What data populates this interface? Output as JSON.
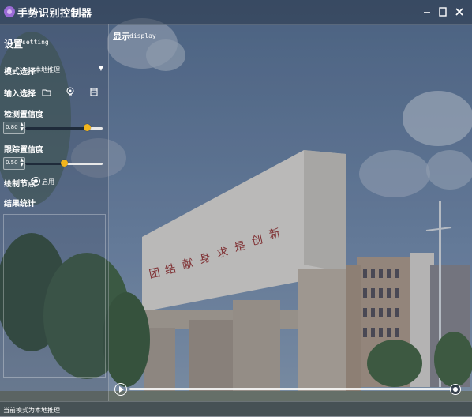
{
  "window": {
    "title": "手势识别控制器",
    "minimize_glyph": "—",
    "maximize_glyph": "☐",
    "close_glyph": "X"
  },
  "settings": {
    "title": "设置",
    "subtitle": "setting",
    "mode_label": "模式选择",
    "mode_value": "本地推理",
    "input_label": "输入选择",
    "input_icons": [
      "folder-icon",
      "camera-icon",
      "file-icon"
    ],
    "det_conf_label": "检测置信度",
    "det_conf_value": "0.80",
    "det_conf_level": 0.8,
    "track_conf_label": "跟踪置信度",
    "track_conf_value": "0.50",
    "track_conf_level": 0.5,
    "draw_nodes_label": "绘制节点",
    "draw_nodes_option": "启用",
    "stats_label": "结果统计"
  },
  "display": {
    "title": "显示",
    "subtitle": "display",
    "playback_position": 1.0
  },
  "status": {
    "text": "当前模式为本地推理"
  },
  "colors": {
    "slider_knob": "#f2b51d",
    "app_icon": "#9b6bd6",
    "slider_track": "#e8e8e8"
  }
}
